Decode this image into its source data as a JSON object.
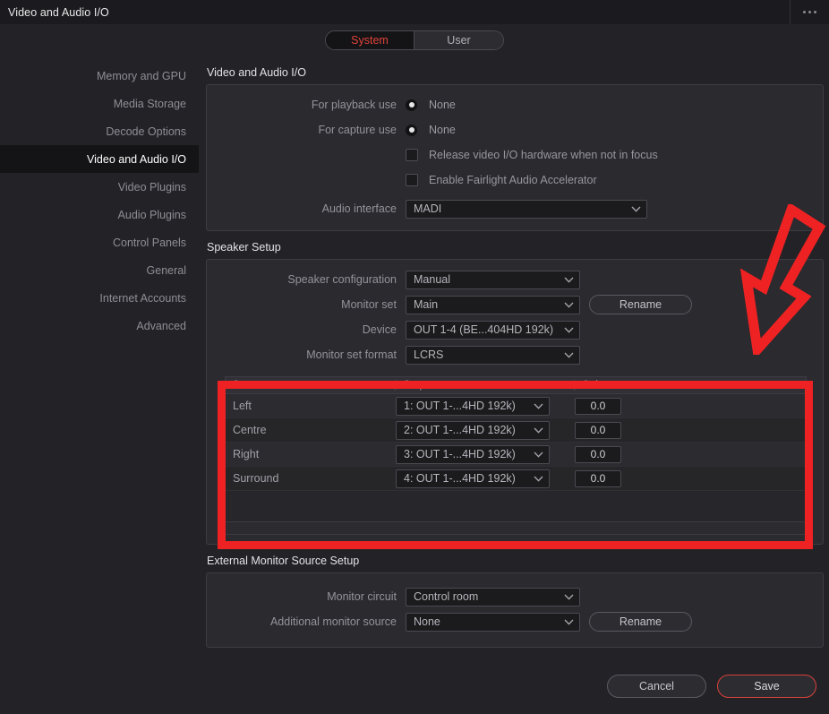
{
  "titlebar": {
    "title": "Video and Audio I/O",
    "menu_icon": "ellipsis-icon"
  },
  "toggle": {
    "options": [
      "System",
      "User"
    ],
    "selected": "System"
  },
  "sidebar": {
    "items": [
      {
        "label": "Memory and GPU",
        "active": false
      },
      {
        "label": "Media Storage",
        "active": false
      },
      {
        "label": "Decode Options",
        "active": false
      },
      {
        "label": "Video and Audio I/O",
        "active": true
      },
      {
        "label": "Video Plugins",
        "active": false
      },
      {
        "label": "Audio Plugins",
        "active": false
      },
      {
        "label": "Control Panels",
        "active": false
      },
      {
        "label": "General",
        "active": false
      },
      {
        "label": "Internet Accounts",
        "active": false
      },
      {
        "label": "Advanced",
        "active": false
      }
    ]
  },
  "video_audio_io": {
    "section_title": "Video and Audio I/O",
    "playback_label": "For playback use",
    "playback_value": "None",
    "capture_label": "For capture use",
    "capture_value": "None",
    "release_hw_label": "Release video I/O hardware when not in focus",
    "fairlight_label": "Enable Fairlight Audio Accelerator",
    "audio_interface_label": "Audio interface",
    "audio_interface_value": "MADI"
  },
  "speaker_setup": {
    "section_title": "Speaker Setup",
    "speaker_config_label": "Speaker configuration",
    "speaker_config_value": "Manual",
    "monitor_set_label": "Monitor set",
    "monitor_set_value": "Main",
    "monitor_set_rename": "Rename",
    "device_label": "Device",
    "device_value": "OUT 1-4 (BE...404HD 192k)",
    "monitor_set_format_label": "Monitor set format",
    "monitor_set_format_value": "LCRS",
    "table": {
      "headers": [
        "Stem",
        "Output",
        "Gain"
      ],
      "rows": [
        {
          "stem": "Left",
          "output": "1: OUT 1-...4HD 192k)",
          "gain": "0.0"
        },
        {
          "stem": "Centre",
          "output": "2: OUT 1-...4HD 192k)",
          "gain": "0.0"
        },
        {
          "stem": "Right",
          "output": "3: OUT 1-...4HD 192k)",
          "gain": "0.0"
        },
        {
          "stem": "Surround",
          "output": "4: OUT 1-...4HD 192k)",
          "gain": "0.0"
        }
      ]
    }
  },
  "external_monitor": {
    "section_title": "External Monitor Source Setup",
    "monitor_circuit_label": "Monitor circuit",
    "monitor_circuit_value": "Control room",
    "additional_source_label": "Additional monitor source",
    "additional_source_value": "None",
    "additional_source_rename": "Rename"
  },
  "footer": {
    "cancel": "Cancel",
    "save": "Save"
  },
  "annotations": {
    "highlight_color": "#ee2222",
    "arrow_color": "#ee2222",
    "arrow_name": "down-left-arrow-annotation",
    "highlight_name": "speaker-table-highlight"
  },
  "colors": {
    "accent_red": "#e0433a",
    "window_bg": "#232327",
    "panel_bg": "#2a2a2f",
    "titlebar_bg": "#1b1b1f"
  }
}
